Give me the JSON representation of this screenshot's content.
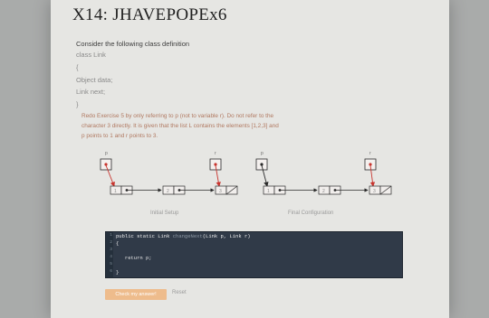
{
  "header": {
    "title": "X14: JHAVEPOPEx6"
  },
  "prompt": {
    "intro": "Consider the following class definition",
    "class_decl": "class Link",
    "open_brace": "{",
    "obj_data": "Object data;",
    "link_next": "Link next;",
    "close_brace": "}",
    "problem_lines": [
      "Redo Exercise 5 by only referring to p (not to variable r). Do not refer to the",
      "character 3 directly. It is given that the list L contains the elements [1,2,3] and",
      "p points to 1 and r points to 3."
    ]
  },
  "diagram": {
    "initial": {
      "caption": "Initial Setup",
      "vars": [
        "p",
        "r"
      ],
      "nodes": [
        "1",
        "2",
        "3"
      ]
    },
    "final": {
      "caption": "Final Configuration",
      "vars": [
        "p",
        "r"
      ],
      "nodes": [
        "1",
        "2",
        "3"
      ]
    },
    "colors": {
      "pointer": "#c8342e",
      "box": "#2a2a2a",
      "accent": "#d16a5c"
    }
  },
  "editor": {
    "line_numbers": [
      "1",
      "2",
      "3",
      "4",
      "5",
      "6"
    ],
    "line1_prefix": "public static Link ",
    "method_name": "changeNext",
    "line1_suffix": "(Link p, Link r)",
    "line2": "{",
    "line4": "   return p;",
    "line6": "}"
  },
  "buttons": {
    "submit_label": "Check my answer!",
    "reset_label": "Reset"
  }
}
